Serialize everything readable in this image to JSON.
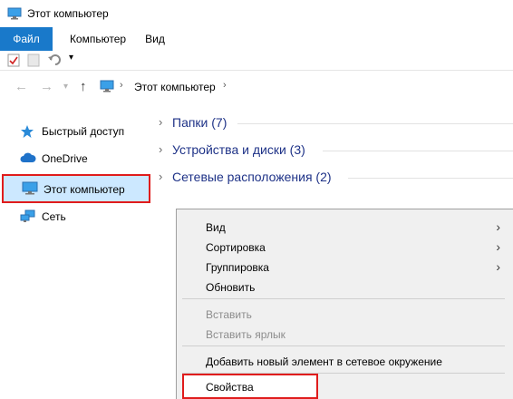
{
  "window": {
    "title": "Этот компьютер"
  },
  "ribbon": {
    "tabs": [
      "Файл",
      "Компьютер",
      "Вид"
    ]
  },
  "address": {
    "path": "Этот компьютер"
  },
  "sidebar": {
    "items": [
      {
        "label": "Быстрый доступ",
        "icon": "star-icon"
      },
      {
        "label": "OneDrive",
        "icon": "cloud-icon"
      },
      {
        "label": "Этот компьютер",
        "icon": "computer-icon",
        "selected": true
      },
      {
        "label": "Сеть",
        "icon": "network-icon"
      }
    ]
  },
  "main": {
    "groups": [
      {
        "label": "Папки (7)"
      },
      {
        "label": "Устройства и диски (3)"
      },
      {
        "label": "Сетевые расположения (2)"
      }
    ]
  },
  "context_menu": {
    "items": [
      {
        "label": "Вид",
        "submenu": true
      },
      {
        "label": "Сортировка",
        "submenu": true
      },
      {
        "label": "Группировка",
        "submenu": true
      },
      {
        "label": "Обновить"
      },
      {
        "label": "Вставить",
        "disabled": true
      },
      {
        "label": "Вставить ярлык",
        "disabled": true
      },
      {
        "label": "Добавить новый элемент в сетевое окружение"
      },
      {
        "label": "Свойства",
        "highlighted": true
      }
    ]
  },
  "colors": {
    "accent": "#1979ca",
    "highlight_border": "#e01c1c",
    "selection": "#cce8ff"
  }
}
